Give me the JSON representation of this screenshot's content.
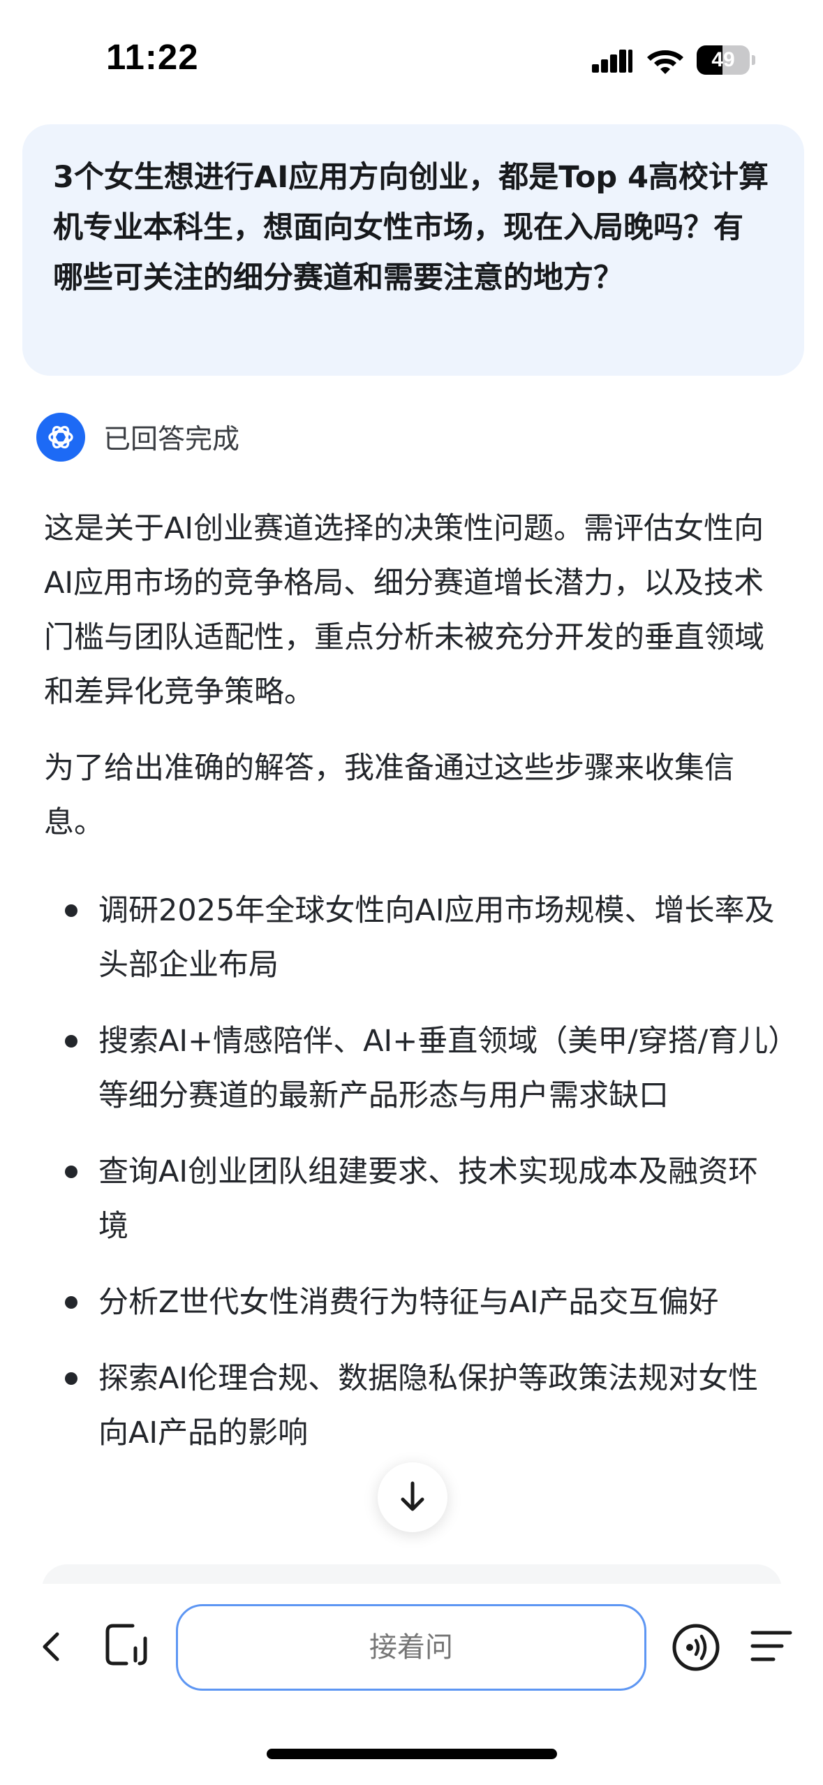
{
  "status_bar": {
    "time": "11:22",
    "battery_percent": "49",
    "battery_level": 0.49,
    "signal_icon": "cellular-signal-icon",
    "wifi_icon": "wifi-icon"
  },
  "question": {
    "text": "3个女生想进行AI应用方向创业，都是Top 4高校计算机专业本科生，想面向女性市场，现在入局晚吗？有哪些可关注的细分赛道和需要注意的地方？"
  },
  "answer": {
    "status": "已回答完成",
    "avatar_icon": "ai-assistant-logo-icon",
    "paragraphs": [
      "这是关于AI创业赛道选择的决策性问题。需评估女性向AI应用市场的竞争格局、细分赛道增长潜力，以及技术门槛与团队适配性，重点分析未被充分开发的垂直领域和差异化竞争策略。",
      "为了给出准确的解答，我准备通过这些步骤来收集信息。"
    ],
    "steps": [
      "调研2025年全球女性向AI应用市场规模、增长率及头部企业布局",
      "搜索AI+情感陪伴、AI+垂直领域（美甲/穿搭/育儿）等细分赛道的最新产品形态与用户需求缺口",
      "查询AI创业团队组建要求、技术实现成本及融资环境",
      "分析Z世代女性消费行为特征与AI产品交互偏好",
      "探索AI伦理合规、数据隐私保护等政策法规对女性向AI产品的影响"
    ]
  },
  "bottom_bar": {
    "input_placeholder": "接着问",
    "back_icon": "chevron-left-icon",
    "new_chat_icon": "new-chat-icon",
    "voice_icon": "voice-call-icon",
    "menu_icon": "menu-icon"
  },
  "colors": {
    "accent": "#1d6af5",
    "question_bg": "#eef4fd",
    "input_border": "#5d96f3",
    "text": "#23262b"
  }
}
